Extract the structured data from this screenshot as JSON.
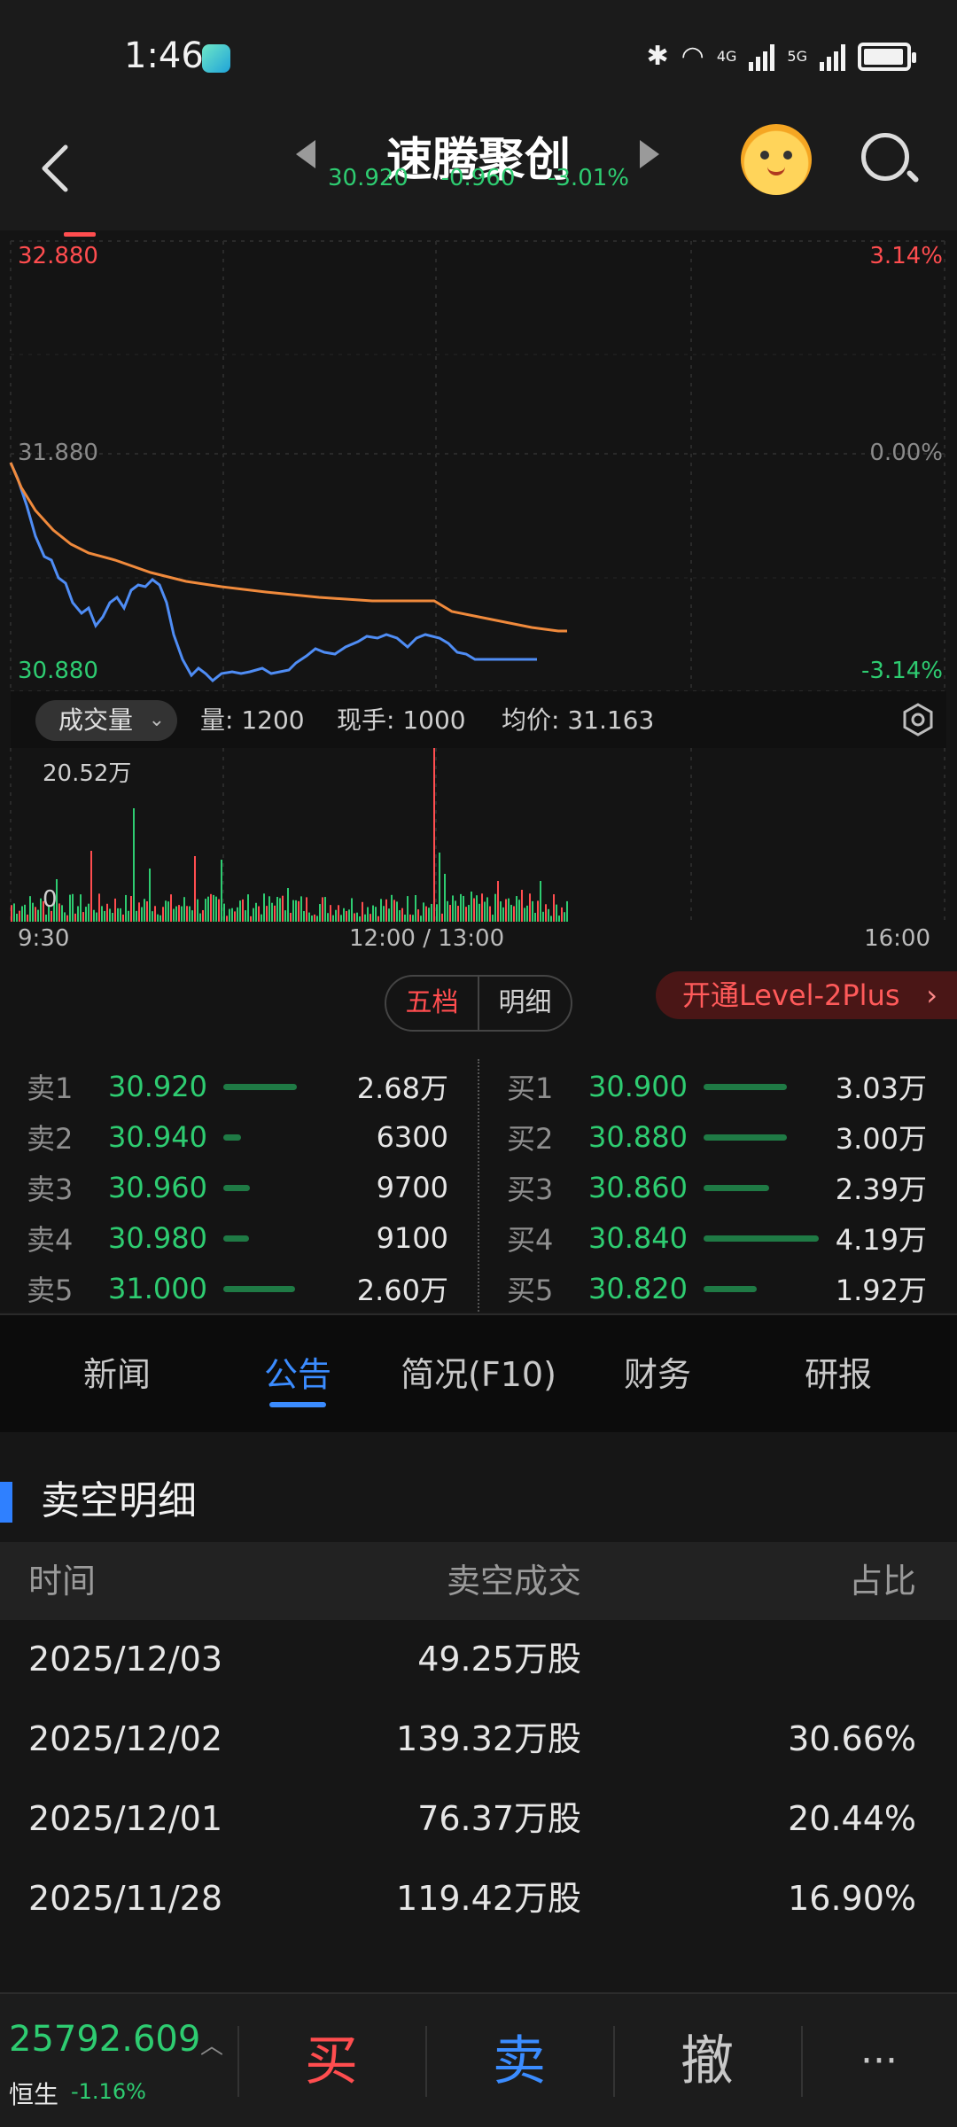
{
  "status_bar": {
    "time": "1:46",
    "network_4g": "4G",
    "network_5g": "5G"
  },
  "header": {
    "title": "速腾聚创",
    "price": "30.920",
    "change": "-0.960",
    "change_pct": "-3.01%"
  },
  "chart": {
    "price_high": "32.880",
    "price_mid": "31.880",
    "price_low": "30.880",
    "pct_high": "3.14%",
    "pct_mid": "0.00%",
    "pct_low": "-3.14%",
    "volume_selector": "成交量",
    "volume_info": "量: 1200",
    "current_hand": "现手: 1000",
    "avg_price": "均价: 31.163",
    "volume_max": "20.52万",
    "volume_zero": "0",
    "time_start": "9:30",
    "time_mid": "12:00 / 13:00",
    "time_end": "16:00",
    "colors": {
      "price_line": "#4f8df5",
      "avg_line": "#f08a3c",
      "up": "#ff4d4f",
      "down": "#2ecc71"
    }
  },
  "orderbook": {
    "tab_active": "五档",
    "tab_other": "明细",
    "level2_label": "开通Level-2Plus",
    "asks": [
      {
        "label": "卖1",
        "price": "30.920",
        "qty": "2.68万",
        "level": 0.64
      },
      {
        "label": "卖2",
        "price": "30.940",
        "qty": "6300",
        "level": 0.15
      },
      {
        "label": "卖3",
        "price": "30.960",
        "qty": "9700",
        "level": 0.23
      },
      {
        "label": "卖4",
        "price": "30.980",
        "qty": "9100",
        "level": 0.22
      },
      {
        "label": "卖5",
        "price": "31.000",
        "qty": "2.60万",
        "level": 0.62
      }
    ],
    "bids": [
      {
        "label": "买1",
        "price": "30.900",
        "qty": "3.03万",
        "level": 0.72
      },
      {
        "label": "买2",
        "price": "30.880",
        "qty": "3.00万",
        "level": 0.72
      },
      {
        "label": "买3",
        "price": "30.860",
        "qty": "2.39万",
        "level": 0.57
      },
      {
        "label": "买4",
        "price": "30.840",
        "qty": "4.19万",
        "level": 1.0
      },
      {
        "label": "买5",
        "price": "30.820",
        "qty": "1.92万",
        "level": 0.46
      }
    ]
  },
  "tabs": [
    "新闻",
    "公告",
    "简况(F10)",
    "财务",
    "研报"
  ],
  "short_selling": {
    "title": "卖空明细",
    "headers": [
      "时间",
      "卖空成交",
      "占比"
    ],
    "rows": [
      {
        "date": "2025/12/03",
        "volume": "49.25万股",
        "ratio": ""
      },
      {
        "date": "2025/12/02",
        "volume": "139.32万股",
        "ratio": "30.66%"
      },
      {
        "date": "2025/12/01",
        "volume": "76.37万股",
        "ratio": "20.44%"
      },
      {
        "date": "2025/11/28",
        "volume": "119.42万股",
        "ratio": "16.90%"
      }
    ]
  },
  "bottom_bar": {
    "index_value": "25792.609",
    "index_name": "恒生",
    "index_change": "-1.16%",
    "buy": "买",
    "sell": "卖",
    "cancel": "撤",
    "more": "···"
  }
}
